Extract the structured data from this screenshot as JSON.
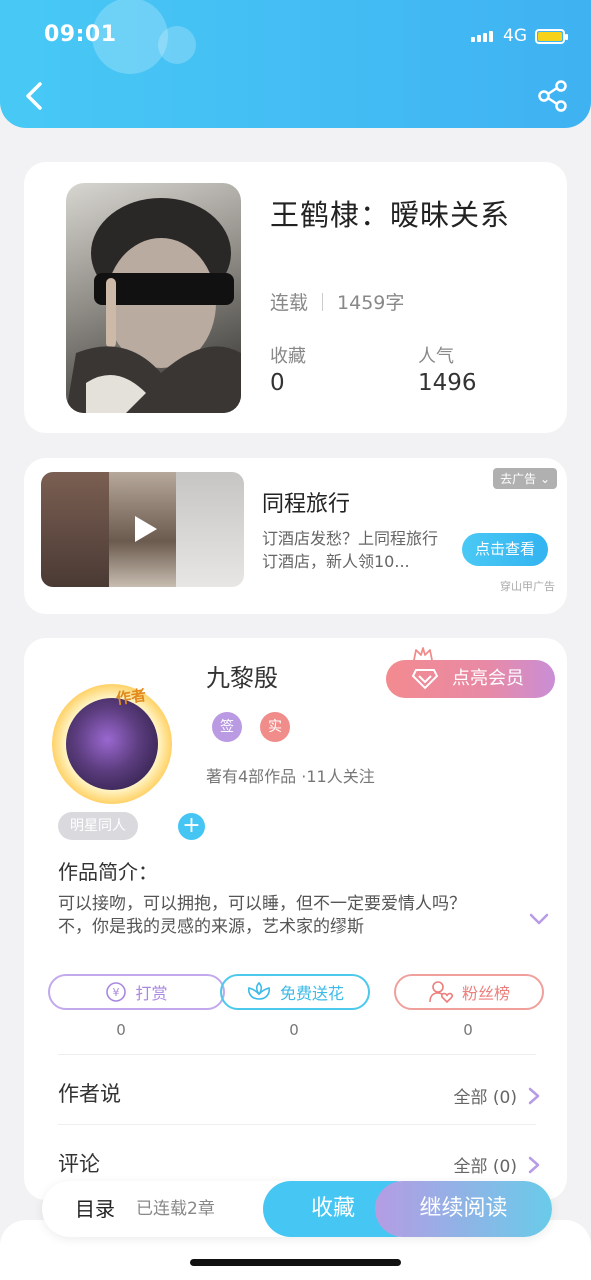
{
  "status_bar": {
    "time": "09:01",
    "network": "4G"
  },
  "book": {
    "title": "王鹤棣：暧昧关系",
    "status": "连载",
    "word_count": "1459字",
    "favorites_label": "收藏",
    "favorites_value": "0",
    "popularity_label": "人气",
    "popularity_value": "1496"
  },
  "ad": {
    "title": "同程旅行",
    "description": "订酒店发愁？上同程旅行订酒店，新人领10...",
    "close_label": "去广告",
    "cta_label": "点击查看",
    "source": "穿山甲广告"
  },
  "author": {
    "name": "九黎殷",
    "avatar_badge": "作者",
    "vip_label": "点亮会员",
    "badge_sign": "签",
    "badge_real": "实",
    "meta": "著有4部作品 ·11人关注",
    "tag": "明星同人",
    "tag_add": "+",
    "intro_label": "作品简介：",
    "intro_text": "可以接吻，可以拥抱，可以睡，但不一定要爱情人吗？不，你是我的灵感的来源，艺术家的缪斯",
    "actions": [
      {
        "label": "打赏",
        "count": "0",
        "color": "#b79be6"
      },
      {
        "label": "免费送花",
        "count": "0",
        "color": "#4cc8ec"
      },
      {
        "label": "粉丝榜",
        "count": "0",
        "color": "#f08d8b"
      }
    ],
    "author_says_label": "作者说",
    "author_says_right": "全部 (0)",
    "comments_label": "评论",
    "comments_right": "全部 (0)"
  },
  "bottom_bar": {
    "toc_label": "目录",
    "toc_sub": "已连载2章",
    "favorite_label": "收藏",
    "read_label": "继续阅读"
  },
  "colors": {
    "accent": "#46c6f3",
    "purple": "#b79be6",
    "pink": "#f08d8b"
  }
}
